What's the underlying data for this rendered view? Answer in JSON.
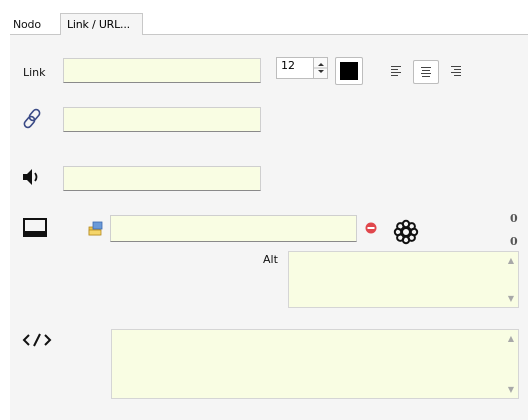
{
  "tabs": [
    {
      "label": "Nodo",
      "active": false
    },
    {
      "label": "Link / URL...",
      "active": true
    }
  ],
  "form": {
    "link_label": "Link",
    "link_value": "",
    "font_size": "12",
    "color": "#000000",
    "alignment_selected": "center",
    "url_value": "",
    "sound_value": "",
    "image_value": "",
    "image_width": "0",
    "image_height": "0",
    "alt_label": "Alt",
    "alt_value": "",
    "code_value": ""
  },
  "icons": {
    "link": "chain-link-icon",
    "sound": "speaker-icon",
    "image": "image-frame-icon",
    "browse": "folder-browse-icon",
    "clear": "remove-icon",
    "settings": "gear-icon",
    "code": "code-tag-icon"
  },
  "colors": {
    "field_bg": "#f9fde3",
    "panel_bg": "#f5f5f5",
    "clear_red": "#e0474c"
  }
}
